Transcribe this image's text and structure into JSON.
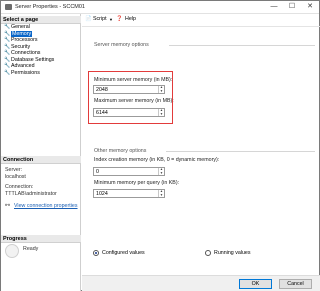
{
  "window": {
    "title": "Server Properties - SCCM01"
  },
  "title_buttons": {
    "minimize": "—",
    "maximize": "☐",
    "close": "✕"
  },
  "left": {
    "select_page": "Select a page",
    "nav": [
      {
        "label": "General"
      },
      {
        "label": "Memory"
      },
      {
        "label": "Processors"
      },
      {
        "label": "Security"
      },
      {
        "label": "Connections"
      },
      {
        "label": "Database Settings"
      },
      {
        "label": "Advanced"
      },
      {
        "label": "Permissions"
      }
    ],
    "connection_header": "Connection",
    "server_label": "Server:",
    "server_value": "localhost",
    "connection_label": "Connection:",
    "connection_value": "TTTLAB\\administrator",
    "view_link": "View connection properties",
    "progress_header": "Progress",
    "progress_status": "Ready"
  },
  "toolbar": {
    "script": "Script",
    "help": "Help"
  },
  "main": {
    "group1": "Server memory options",
    "min_label": "Minimum server memory (in MB):",
    "min_value": "2048",
    "max_label": "Maximum server memory (in MB):",
    "max_value": "6144",
    "group2": "Other memory options",
    "index_label": "Index creation memory (in KB, 0 = dynamic memory):",
    "index_value": "0",
    "query_label": "Minimum memory per query (in KB):",
    "query_value": "1024",
    "configured": "Configured values",
    "running": "Running values"
  },
  "footer": {
    "ok": "OK",
    "cancel": "Cancel"
  }
}
